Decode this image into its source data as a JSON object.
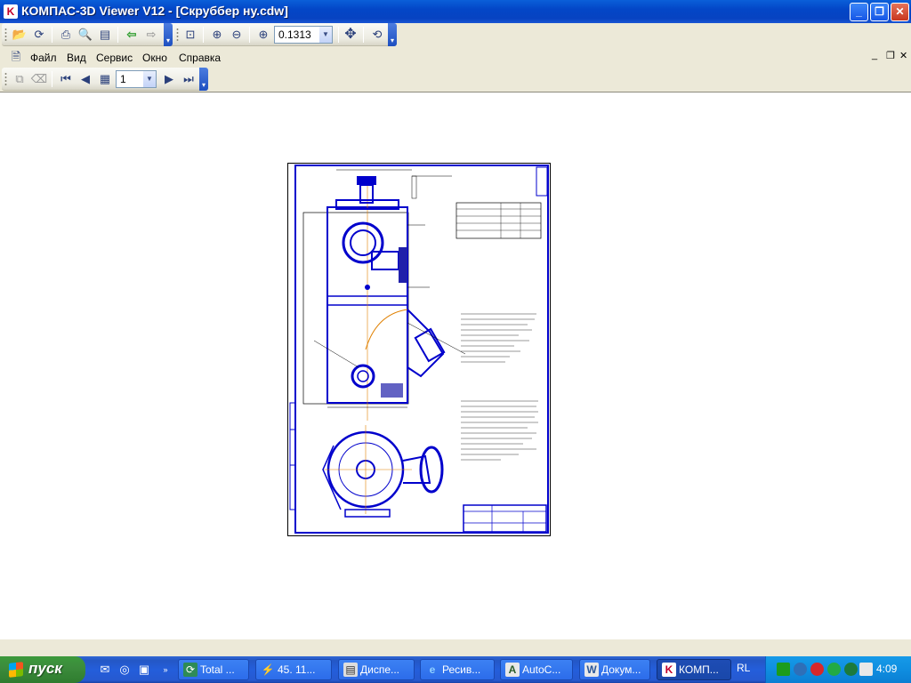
{
  "window": {
    "title": "КОМПАС-3D Viewer V12 - [Скруббер ну.cdw]",
    "app_icon": "kompas-icon"
  },
  "toolbar_main": {
    "zoom_value": "0.1313",
    "icons": [
      "open-icon",
      "reopen-icon",
      "print-icon",
      "print-preview-icon",
      "page-setup-icon",
      "back-arrow-icon",
      "forward-arrow-icon",
      "zoom-frame-icon",
      "zoom-in-icon",
      "zoom-out-icon",
      "zoom-scale-icon",
      "pan-icon",
      "refresh-icon"
    ]
  },
  "menu": {
    "items": [
      {
        "label": "Файл"
      },
      {
        "label": "Вид"
      },
      {
        "label": "Сервис"
      },
      {
        "label": "Окно"
      },
      {
        "label": "Справка"
      }
    ]
  },
  "toolbar_doc": {
    "page_value": "1"
  },
  "taskbar": {
    "start_label": "пуск",
    "tasks": [
      {
        "label": "Total ...",
        "icon": "total-commander-icon",
        "color": "#2e8b57"
      },
      {
        "label": "45. 11...",
        "icon": "lightning-icon",
        "color": "#e88d1a"
      },
      {
        "label": "Диспе...",
        "icon": "task-manager-icon",
        "color": "#555555"
      },
      {
        "label": "Ресив...",
        "icon": "ie-icon",
        "color": "#2a7ad8"
      },
      {
        "label": "AutoC...",
        "icon": "autocad-icon",
        "color": "#d0d0d0"
      },
      {
        "label": "Докум...",
        "icon": "word-icon",
        "color": "#2b579a"
      },
      {
        "label": "КОМП...",
        "icon": "kompas-icon",
        "color": "#c2002b"
      }
    ],
    "language": "RL",
    "clock": "4:09"
  },
  "colors": {
    "drawing_line": "#0000cc",
    "drawing_frame": "#000000",
    "axis_line": "#e08000"
  }
}
